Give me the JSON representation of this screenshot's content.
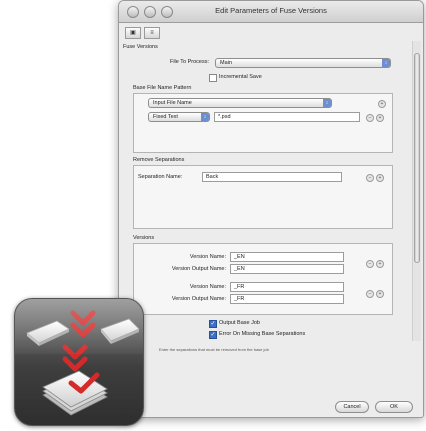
{
  "window": {
    "title": "Edit Parameters of Fuse Versions"
  },
  "toolbar": {
    "icons": [
      "inspector-icon",
      "list-view-icon"
    ]
  },
  "section_title": "Fuse Versions",
  "file_to_process": {
    "label": "File To Process:",
    "value": "Main"
  },
  "incremental_save": {
    "label": "Incremental Save",
    "checked": false
  },
  "base_file_name_pattern": {
    "title": "Base File Name Pattern",
    "rows": [
      {
        "type": "Input File Name"
      },
      {
        "type": "Fixed Text",
        "value": "*.psd"
      }
    ]
  },
  "remove_separations": {
    "title": "Remove Separations",
    "label": "Separation Name:",
    "value": "Back"
  },
  "versions": {
    "title": "Versions",
    "entries": [
      {
        "name_label": "Version Name:",
        "name_value": "_EN",
        "output_label": "Version Output Name:",
        "output_value": "_EN"
      },
      {
        "name_label": "Version Name:",
        "name_value": "_FR",
        "output_label": "Version Output Name:",
        "output_value": "_FR"
      }
    ]
  },
  "output_base_job": {
    "label": "Output Base Job",
    "checked": true
  },
  "error_missing": {
    "label": "Error On Missing Base Separations",
    "checked": true
  },
  "hint": "Enter the separations that must be removed from the base job",
  "buttons": {
    "cancel": "Cancel",
    "ok": "OK"
  },
  "app_icon": "fuse-versions-app-icon",
  "colors": {
    "accent": "#6d8fd0",
    "check": "#d42a2a"
  }
}
